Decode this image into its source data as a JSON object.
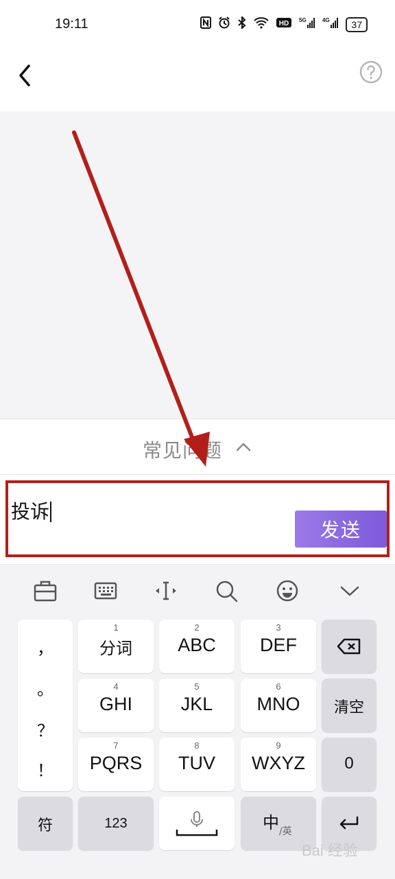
{
  "status_bar": {
    "time": "19:11",
    "icons": [
      "nfc-icon",
      "alarm-icon",
      "bluetooth-icon",
      "wifi-icon",
      "hd-icon",
      "5g-signal-icon",
      "4g-signal-icon"
    ],
    "battery": "37"
  },
  "header": {
    "back_icon": "chevron-left-icon",
    "help_icon": "question-circle-icon"
  },
  "faq": {
    "label": "常见问题"
  },
  "input": {
    "value": "投诉",
    "send_label": "发送"
  },
  "keyboard": {
    "toolbar": [
      "toolbox-icon",
      "keyboard-icon",
      "cursor-icon",
      "search-icon",
      "emoji-icon",
      "collapse-icon"
    ],
    "punctuation": [
      "，",
      "。",
      "？",
      "！"
    ],
    "keys": [
      {
        "num": "1",
        "label": "分词"
      },
      {
        "num": "2",
        "label": "ABC"
      },
      {
        "num": "3",
        "label": "DEF"
      },
      {
        "num": "4",
        "label": "GHI"
      },
      {
        "num": "5",
        "label": "JKL"
      },
      {
        "num": "6",
        "label": "MNO"
      },
      {
        "num": "7",
        "label": "PQRS"
      },
      {
        "num": "8",
        "label": "TUV"
      },
      {
        "num": "9",
        "label": "WXYZ"
      }
    ],
    "side": {
      "clear": "清空",
      "zero": "0"
    },
    "bottom": {
      "symbols": "符",
      "numbers": "123",
      "lang_main": "中",
      "lang_sub": "/英"
    }
  },
  "watermark": "Bai 经验",
  "colors": {
    "accent": "#8b68e0",
    "annotation": "#b21f1a"
  }
}
